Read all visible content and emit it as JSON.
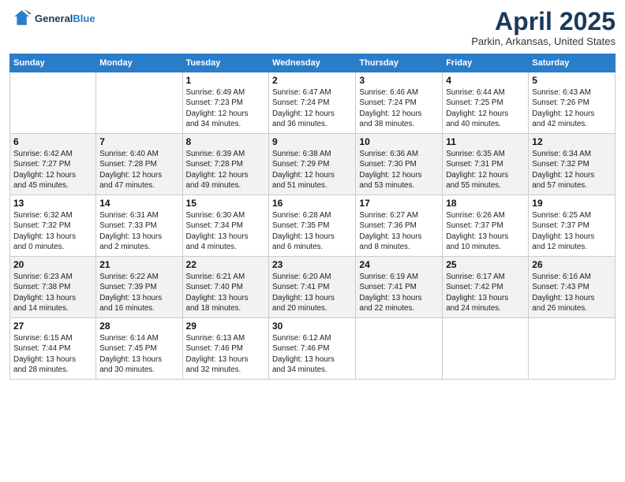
{
  "header": {
    "logo_line1": "General",
    "logo_line2": "Blue",
    "month": "April 2025",
    "location": "Parkin, Arkansas, United States"
  },
  "weekdays": [
    "Sunday",
    "Monday",
    "Tuesday",
    "Wednesday",
    "Thursday",
    "Friday",
    "Saturday"
  ],
  "weeks": [
    [
      {
        "day": "",
        "info": ""
      },
      {
        "day": "",
        "info": ""
      },
      {
        "day": "1",
        "info": "Sunrise: 6:49 AM\nSunset: 7:23 PM\nDaylight: 12 hours\nand 34 minutes."
      },
      {
        "day": "2",
        "info": "Sunrise: 6:47 AM\nSunset: 7:24 PM\nDaylight: 12 hours\nand 36 minutes."
      },
      {
        "day": "3",
        "info": "Sunrise: 6:46 AM\nSunset: 7:24 PM\nDaylight: 12 hours\nand 38 minutes."
      },
      {
        "day": "4",
        "info": "Sunrise: 6:44 AM\nSunset: 7:25 PM\nDaylight: 12 hours\nand 40 minutes."
      },
      {
        "day": "5",
        "info": "Sunrise: 6:43 AM\nSunset: 7:26 PM\nDaylight: 12 hours\nand 42 minutes."
      }
    ],
    [
      {
        "day": "6",
        "info": "Sunrise: 6:42 AM\nSunset: 7:27 PM\nDaylight: 12 hours\nand 45 minutes."
      },
      {
        "day": "7",
        "info": "Sunrise: 6:40 AM\nSunset: 7:28 PM\nDaylight: 12 hours\nand 47 minutes."
      },
      {
        "day": "8",
        "info": "Sunrise: 6:39 AM\nSunset: 7:28 PM\nDaylight: 12 hours\nand 49 minutes."
      },
      {
        "day": "9",
        "info": "Sunrise: 6:38 AM\nSunset: 7:29 PM\nDaylight: 12 hours\nand 51 minutes."
      },
      {
        "day": "10",
        "info": "Sunrise: 6:36 AM\nSunset: 7:30 PM\nDaylight: 12 hours\nand 53 minutes."
      },
      {
        "day": "11",
        "info": "Sunrise: 6:35 AM\nSunset: 7:31 PM\nDaylight: 12 hours\nand 55 minutes."
      },
      {
        "day": "12",
        "info": "Sunrise: 6:34 AM\nSunset: 7:32 PM\nDaylight: 12 hours\nand 57 minutes."
      }
    ],
    [
      {
        "day": "13",
        "info": "Sunrise: 6:32 AM\nSunset: 7:32 PM\nDaylight: 13 hours\nand 0 minutes."
      },
      {
        "day": "14",
        "info": "Sunrise: 6:31 AM\nSunset: 7:33 PM\nDaylight: 13 hours\nand 2 minutes."
      },
      {
        "day": "15",
        "info": "Sunrise: 6:30 AM\nSunset: 7:34 PM\nDaylight: 13 hours\nand 4 minutes."
      },
      {
        "day": "16",
        "info": "Sunrise: 6:28 AM\nSunset: 7:35 PM\nDaylight: 13 hours\nand 6 minutes."
      },
      {
        "day": "17",
        "info": "Sunrise: 6:27 AM\nSunset: 7:36 PM\nDaylight: 13 hours\nand 8 minutes."
      },
      {
        "day": "18",
        "info": "Sunrise: 6:26 AM\nSunset: 7:37 PM\nDaylight: 13 hours\nand 10 minutes."
      },
      {
        "day": "19",
        "info": "Sunrise: 6:25 AM\nSunset: 7:37 PM\nDaylight: 13 hours\nand 12 minutes."
      }
    ],
    [
      {
        "day": "20",
        "info": "Sunrise: 6:23 AM\nSunset: 7:38 PM\nDaylight: 13 hours\nand 14 minutes."
      },
      {
        "day": "21",
        "info": "Sunrise: 6:22 AM\nSunset: 7:39 PM\nDaylight: 13 hours\nand 16 minutes."
      },
      {
        "day": "22",
        "info": "Sunrise: 6:21 AM\nSunset: 7:40 PM\nDaylight: 13 hours\nand 18 minutes."
      },
      {
        "day": "23",
        "info": "Sunrise: 6:20 AM\nSunset: 7:41 PM\nDaylight: 13 hours\nand 20 minutes."
      },
      {
        "day": "24",
        "info": "Sunrise: 6:19 AM\nSunset: 7:41 PM\nDaylight: 13 hours\nand 22 minutes."
      },
      {
        "day": "25",
        "info": "Sunrise: 6:17 AM\nSunset: 7:42 PM\nDaylight: 13 hours\nand 24 minutes."
      },
      {
        "day": "26",
        "info": "Sunrise: 6:16 AM\nSunset: 7:43 PM\nDaylight: 13 hours\nand 26 minutes."
      }
    ],
    [
      {
        "day": "27",
        "info": "Sunrise: 6:15 AM\nSunset: 7:44 PM\nDaylight: 13 hours\nand 28 minutes."
      },
      {
        "day": "28",
        "info": "Sunrise: 6:14 AM\nSunset: 7:45 PM\nDaylight: 13 hours\nand 30 minutes."
      },
      {
        "day": "29",
        "info": "Sunrise: 6:13 AM\nSunset: 7:46 PM\nDaylight: 13 hours\nand 32 minutes."
      },
      {
        "day": "30",
        "info": "Sunrise: 6:12 AM\nSunset: 7:46 PM\nDaylight: 13 hours\nand 34 minutes."
      },
      {
        "day": "",
        "info": ""
      },
      {
        "day": "",
        "info": ""
      },
      {
        "day": "",
        "info": ""
      }
    ]
  ]
}
